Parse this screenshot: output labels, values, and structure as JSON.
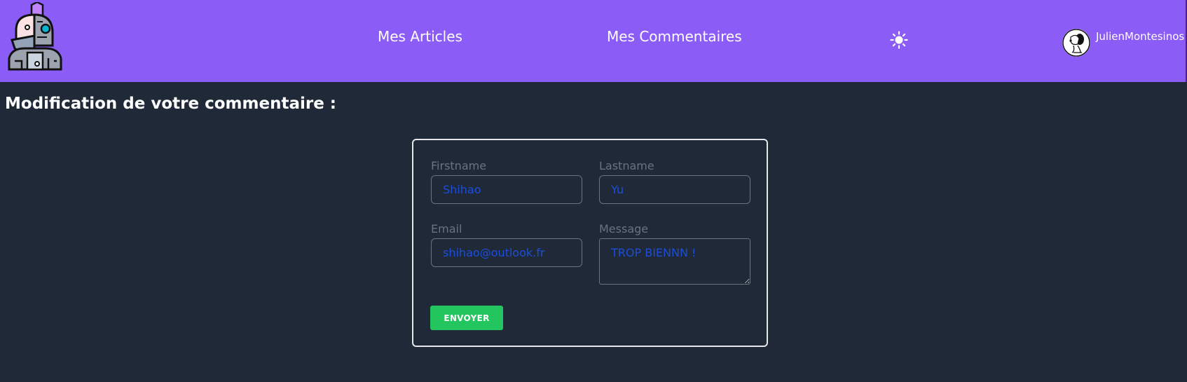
{
  "navbar": {
    "links": [
      {
        "label": "Mes Articles"
      },
      {
        "label": "Mes Commentaires"
      }
    ],
    "theme_icon": "sun-icon",
    "user": {
      "name": "JulienMontesinos",
      "avatar_icon": "snoopy-avatar"
    },
    "logo_icon": "cyborg-logo",
    "color": "#8b5cf6"
  },
  "page": {
    "title": "Modification de votre commentaire :",
    "background": "#1f2937"
  },
  "form": {
    "firstname": {
      "label": "Firstname",
      "value": "Shihao"
    },
    "lastname": {
      "label": "Lastname",
      "value": "Yu"
    },
    "email": {
      "label": "Email",
      "value": "shihao@outlook.fr"
    },
    "message": {
      "label": "Message",
      "value": "TROP BIENNN !"
    },
    "submit_label": "ENVOYER",
    "submit_color": "#22c55e"
  }
}
